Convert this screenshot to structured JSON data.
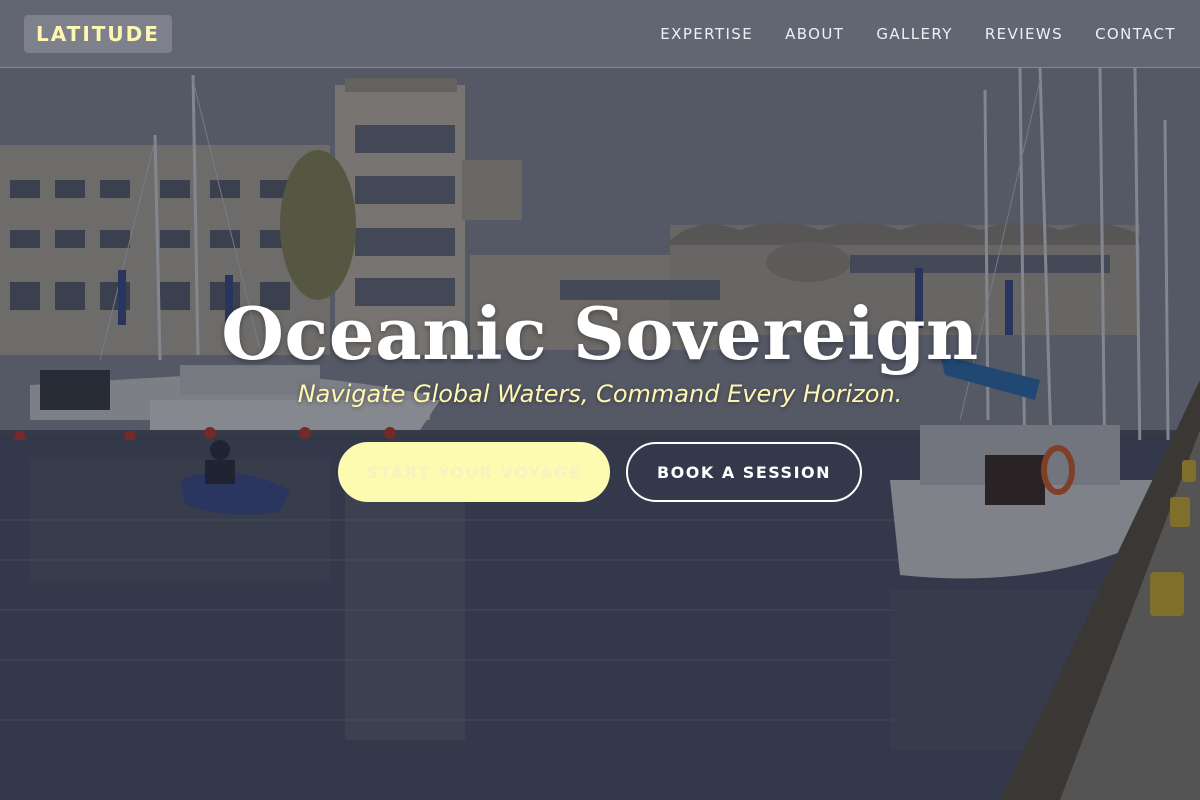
{
  "header": {
    "logo": "LATITUDE",
    "nav": [
      {
        "label": "EXPERTISE"
      },
      {
        "label": "ABOUT"
      },
      {
        "label": "GALLERY"
      },
      {
        "label": "REVIEWS"
      },
      {
        "label": "CONTACT"
      }
    ]
  },
  "hero": {
    "title": "Oceanic Sovereign",
    "subtitle": "Navigate Global Waters, Command Every Horizon.",
    "primary_button": "START YOUR VOYAGE",
    "secondary_button": "BOOK A SESSION"
  },
  "colors": {
    "accent": "#fdfbb0",
    "logo_text": "#fdf7b2",
    "overlay": "rgba(20,24,38,0.45)"
  }
}
